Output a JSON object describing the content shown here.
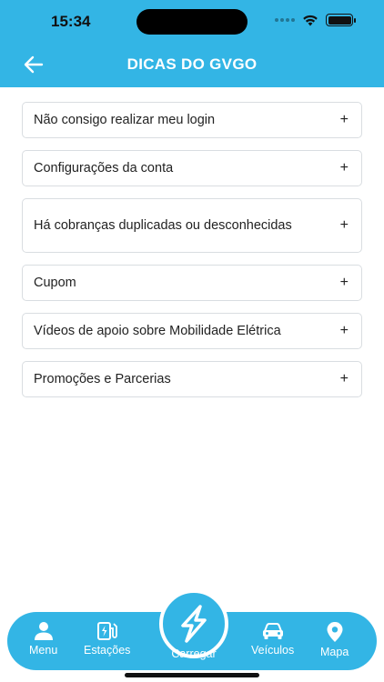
{
  "colors": {
    "brand": "#33b5e5",
    "text": "#222222",
    "border": "#d9dde1"
  },
  "status": {
    "time": "15:34"
  },
  "header": {
    "title": "DICAS DO GVGO",
    "back_icon": "arrow-left-icon"
  },
  "faq": [
    {
      "label": "Não consigo realizar meu login",
      "icon": "plus-icon",
      "expand": "+"
    },
    {
      "label": "Configurações da conta",
      "icon": "plus-icon",
      "expand": "+"
    },
    {
      "label": "Há cobranças duplicadas ou desconhecidas",
      "icon": "plus-icon",
      "expand": "+"
    },
    {
      "label": "Cupom",
      "icon": "plus-icon",
      "expand": "+"
    },
    {
      "label": "Vídeos de apoio sobre Mobilidade Elétrica",
      "icon": "plus-icon",
      "expand": "+"
    },
    {
      "label": "Promoções e Parcerias",
      "icon": "plus-icon",
      "expand": "+"
    }
  ],
  "tabbar": {
    "menu": {
      "label": "Menu",
      "icon": "user-icon"
    },
    "stations": {
      "label": "Estações",
      "icon": "charging-station-icon"
    },
    "charge": {
      "label": "Carregar",
      "icon": "lightning-icon"
    },
    "vehicles": {
      "label": "Veículos",
      "icon": "car-icon"
    },
    "map": {
      "label": "Mapa",
      "icon": "map-pin-icon"
    }
  }
}
